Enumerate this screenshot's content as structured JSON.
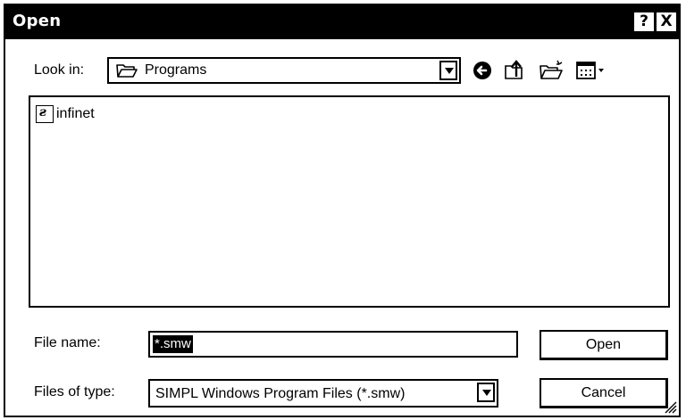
{
  "window": {
    "title": "Open",
    "help_label": "?",
    "close_label": "X"
  },
  "lookin": {
    "label": "Look in:",
    "value": "Programs"
  },
  "toolbar": {
    "back_icon": "back-arrow-icon",
    "up_icon": "up-folder-icon",
    "new_folder_icon": "new-folder-icon",
    "view_icon": "view-menu-icon"
  },
  "files": [
    {
      "name": "infinet",
      "icon": "program-file-icon"
    }
  ],
  "filename": {
    "label": "File name:",
    "value": "*.smw"
  },
  "filetype": {
    "label": "Files of type:",
    "value": "SIMPL Windows Program Files (*.smw)"
  },
  "buttons": {
    "open": "Open",
    "cancel": "Cancel"
  }
}
